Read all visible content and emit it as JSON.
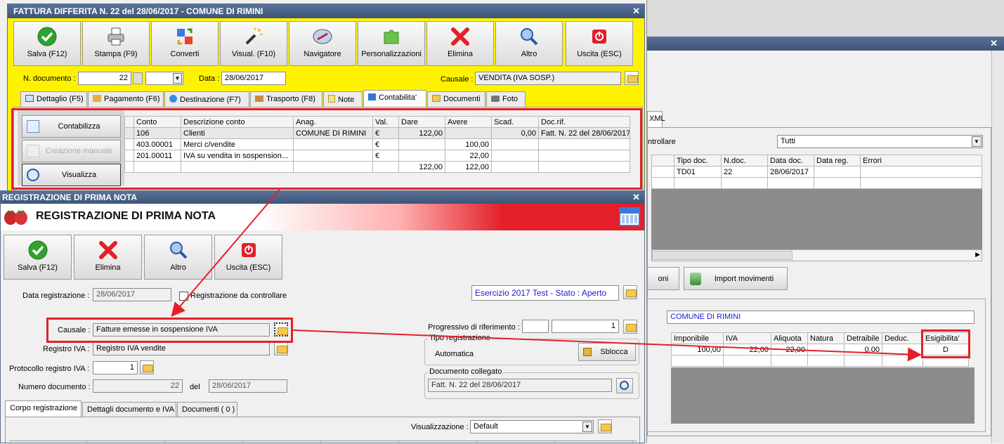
{
  "bg_window": {
    "tab_xml": "XML",
    "filter_label": "ntrollare",
    "filter_value": "Tutti",
    "grid_headers": [
      "Tipo doc.",
      "N.doc.",
      "Data doc.",
      "Data reg.",
      "Errori"
    ],
    "grid_row": [
      "TD01",
      "22",
      "28/06/2017",
      "",
      ""
    ],
    "btn_partial": "oni",
    "btn_import": "Import movimenti",
    "anag": "COMUNE DI RIMINI",
    "iva_headers": [
      "Imponibile",
      "IVA",
      "Aliquota",
      "Natura",
      "Detraibile",
      "Deduc.",
      "Esigibilita'"
    ],
    "iva_row": [
      "100,00",
      "22,00",
      "22,00",
      "",
      "0,00",
      "",
      "D"
    ]
  },
  "fattura": {
    "title": "FATTURA DIFFERITA N. 22 del 28/06/2017 - COMUNE DI RIMINI",
    "toolbar": [
      "Salva (F12)",
      "Stampa (F9)",
      "Converti",
      "Visual. (F10)",
      "Navigatore",
      "Personalizzazioni",
      "Elimina",
      "Altro",
      "Uscita (ESC)"
    ],
    "ndoc_label": "N. documento :",
    "ndoc_value": "22",
    "data_label": "Data :",
    "data_value": "28/06/2017",
    "causale_label": "Causale :",
    "causale_value": "VENDITA (IVA SOSP.)",
    "tabs": [
      "Dettaglio (F5)",
      "Pagamento (F6)",
      "Destinazione (F7)",
      "Trasporto (F8)",
      "Note",
      "Contabilita'",
      "Documenti",
      "Foto"
    ],
    "side_buttons": [
      "Contabilizza",
      "Creazione manuale",
      "Visualizza"
    ],
    "grid_headers": [
      "Conto",
      "Descrizione conto",
      "Anag.",
      "Val.",
      "Dare",
      "Avere",
      "Scad.",
      "Doc.rif."
    ],
    "grid_rows": [
      [
        "106",
        "Clienti",
        "COMUNE DI RIMINI",
        "€",
        "122,00",
        "",
        "0,00",
        "Fatt. N. 22 del 28/06/2017"
      ],
      [
        "403.00001",
        "Merci c/vendite",
        "",
        "€",
        "",
        "100,00",
        "",
        ""
      ],
      [
        "201.00011",
        "IVA su vendita in sospension...",
        "",
        "€",
        "",
        "22,00",
        "",
        ""
      ],
      [
        "",
        "",
        "",
        "",
        "122,00",
        "122,00",
        "",
        ""
      ]
    ]
  },
  "prima_nota": {
    "title": "REGISTRAZIONE DI PRIMA NOTA",
    "header": "REGISTRAZIONE DI PRIMA NOTA",
    "toolbar": [
      "Salva (F12)",
      "Elimina",
      "Altro",
      "Uscita (ESC)"
    ],
    "data_reg_label": "Data registrazione :",
    "data_reg_value": "28/06/2017",
    "da_controllare": "Registrazione da controllare",
    "esercizio": "Esercizio 2017 Test - Stato : Aperto",
    "causale_label": "Causale :",
    "causale_value": "Fatture emesse in sospensione IVA",
    "progressivo_label": "Progressivo di riferimento :",
    "progressivo_value": "1",
    "registro_label": "Registro IVA :",
    "registro_value": "Registro IVA vendite",
    "tipo_reg_label": "Tipo registrazione",
    "tipo_reg_value": "Automatica",
    "sblocca": "Sblocca",
    "protocollo_label": "Protocollo registro IVA :",
    "protocollo_value": "1",
    "numdoc_label": "Numero documento :",
    "numdoc_value": "22",
    "del_label": "del",
    "del_value": "28/06/2017",
    "doc_collegato_label": "Documento collegato",
    "doc_collegato_value": "Fatt. N. 22 del 28/06/2017",
    "tabs": [
      "Corpo registrazione",
      "Dettagli documento e IVA",
      "Documenti ( 0 )"
    ],
    "visual_label": "Visualizzazione :",
    "visual_value": "Default"
  },
  "colors": {
    "accent_red": "#e3202a",
    "yellow": "#fff200",
    "title_blue": "#4a6391",
    "link_blue": "#1c1ccc"
  }
}
